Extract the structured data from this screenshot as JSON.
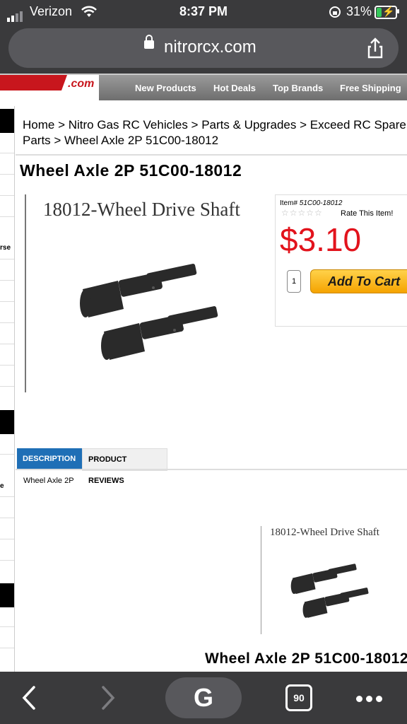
{
  "status_bar": {
    "carrier": "Verizon",
    "time": "8:37 PM",
    "battery_percent": "31%",
    "battery_level": 0.31
  },
  "browser": {
    "host": "nitrorcx.com",
    "tab_count": "90"
  },
  "site": {
    "logo_text": ".com",
    "nav": [
      "New Products",
      "Hot Deals",
      "Top Brands",
      "Free Shipping"
    ],
    "sidebar_fragments": [
      "rse",
      "e"
    ]
  },
  "breadcrumb": {
    "text": "Home > Nitro Gas RC Vehicles > Parts & Upgrades > Exceed RC Spare Parts > Wheel Axle 2P 51C00-18012"
  },
  "product": {
    "title": "Wheel Axle 2P 51C00-18012",
    "image_caption": "18012-Wheel Drive Shaft",
    "item_label": "Item#",
    "item_number": "51C00-18012",
    "stars": "☆☆☆☆☆",
    "rate_label": "Rate This Item!",
    "price": "$3.10",
    "qty": "1",
    "add_to_cart": "Add To Cart"
  },
  "tabs": {
    "description": "DESCRIPTION",
    "reviews": "PRODUCT REVIEWS"
  },
  "description": {
    "text": "Wheel Axle 2P",
    "image_caption": "18012-Wheel Drive Shaft",
    "title": "Wheel Axle 2P 51C00-18012"
  }
}
